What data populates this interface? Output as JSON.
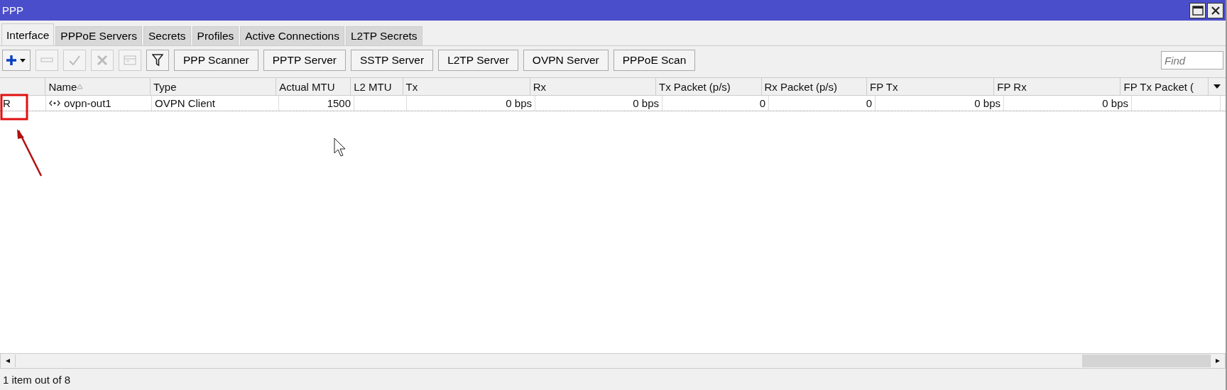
{
  "window": {
    "title": "PPP"
  },
  "tabs": [
    {
      "label": "Interface",
      "selected": true
    },
    {
      "label": "PPPoE Servers",
      "selected": false
    },
    {
      "label": "Secrets",
      "selected": false
    },
    {
      "label": "Profiles",
      "selected": false
    },
    {
      "label": "Active Connections",
      "selected": false
    },
    {
      "label": "L2TP Secrets",
      "selected": false
    }
  ],
  "toolbar": {
    "buttons": [
      {
        "kind": "add",
        "disabled": false
      },
      {
        "kind": "remove",
        "disabled": true
      },
      {
        "kind": "enable",
        "disabled": true
      },
      {
        "kind": "disable",
        "disabled": true
      },
      {
        "kind": "comment",
        "disabled": true
      },
      {
        "kind": "filter",
        "disabled": false
      }
    ],
    "text_buttons": [
      "PPP Scanner",
      "PPTP Server",
      "SSTP Server",
      "L2TP Server",
      "OVPN Server",
      "PPPoE Scan"
    ],
    "search": {
      "placeholder": "Find"
    }
  },
  "table": {
    "columns": [
      {
        "sorted": false
      },
      {
        "label": "Name",
        "sorted": true
      },
      {
        "label": "Type",
        "sorted": false
      },
      {
        "label": "Actual MTU",
        "sorted": false
      },
      {
        "label": "L2 MTU",
        "sorted": false
      },
      {
        "label": "Tx",
        "sorted": false
      },
      {
        "label": "Rx",
        "sorted": false
      },
      {
        "label": "Tx Packet (p/s)",
        "sorted": false
      },
      {
        "label": "Rx Packet (p/s)",
        "sorted": false
      },
      {
        "label": "FP Tx",
        "sorted": false
      },
      {
        "label": "FP Rx",
        "sorted": false
      },
      {
        "label": "FP Tx Packet (",
        "sorted": false
      }
    ],
    "rows": [
      {
        "cells": [
          "R",
          "ovpn-out1",
          "OVPN Client",
          "1500",
          "",
          "0 bps",
          "0 bps",
          "0",
          "0",
          "0 bps",
          "0 bps",
          ""
        ]
      }
    ]
  },
  "status_bar": "1 item out of 8"
}
